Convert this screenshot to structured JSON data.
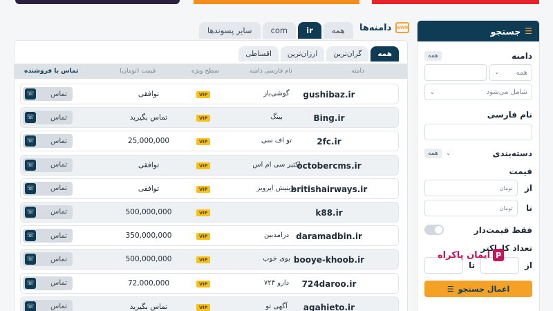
{
  "main": {
    "title": "دامنه‌ها",
    "tld_tabs": [
      "سایر پسوندها",
      "com",
      "ir",
      "همه"
    ],
    "sort_tabs": [
      "همه",
      "گران‌ترین",
      "ارزان‌ترین",
      "اقساطی"
    ],
    "columns": {
      "domain": "دامنه",
      "fa_name": "نام فارسی دامنه",
      "level": "سطح ویژه",
      "price": "قیمت (تومان)",
      "contact": "تماس با فروشنده"
    },
    "vip_label": "VIP",
    "contact_label": "تماس",
    "rows": [
      {
        "domain": "gushibaz.ir",
        "fa": "گوشی‌باز",
        "price": "توافقی"
      },
      {
        "domain": "Bing.ir",
        "fa": "بینگ",
        "price": "تماس بگیرید"
      },
      {
        "domain": "2fc.ir",
        "fa": "تو اف سی",
        "price": "25,000,000"
      },
      {
        "domain": "octobercms.ir",
        "fa": "اکتبر سی ام اس",
        "price": "توافقی"
      },
      {
        "domain": "britishairways.ir",
        "fa": "بریتیش ایرویز",
        "price": "توافقی"
      },
      {
        "domain": "k88.ir",
        "fa": "",
        "price": "500,000,000"
      },
      {
        "domain": "daramadbin.ir",
        "fa": "درامدبین",
        "price": "350,000,000"
      },
      {
        "domain": "booye-khoob.ir",
        "fa": "بوی خوب",
        "price": "500,000,000"
      },
      {
        "domain": "724daroo.ir",
        "fa": "۷۲۴ دارو",
        "price": "72,000,000"
      },
      {
        "domain": "agahieto.ir",
        "fa": "آگهی تو",
        "price": "تماس بگیرید"
      }
    ]
  },
  "sidebar": {
    "title": "جستجو",
    "domain_label": "دامنه",
    "domain_chip": "همه",
    "domain_select": "همه",
    "match_select": "شامل می‌شود",
    "fa_name_label": "نام فارسی",
    "category_label": "دسته‌بندی",
    "category_chip": "همه",
    "price_label": "قیمت",
    "from_label": "از",
    "to_label": "تا",
    "price_placeholder": "تومان",
    "priced_only_label": "فقط قیمت‌دار",
    "char_count_label": "تعداد کاراکتر",
    "apply_label": "اعمال جستجو"
  },
  "watermark": "ایمان پاکراه",
  "colors": {
    "primary": "#0f3b54",
    "accent": "#f5a125",
    "vip": "#f5c21b"
  }
}
